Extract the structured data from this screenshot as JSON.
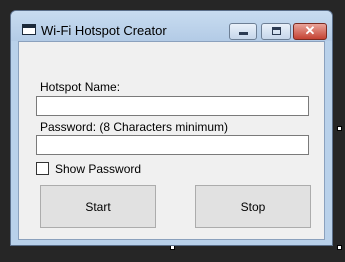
{
  "window": {
    "title": "Wi-Fi Hotspot Creator",
    "close_glyph": "✕",
    "icons": [
      "window-icon",
      "minimize-icon",
      "maximize-icon",
      "close-icon"
    ]
  },
  "form": {
    "hotspot_name_label": "Hotspot Name:",
    "hotspot_name_value": "",
    "password_label": "Password: (8 Characters minimum)",
    "password_value": "",
    "show_password_label": "Show Password",
    "show_password_checked": false
  },
  "buttons": {
    "start_label": "Start",
    "stop_label": "Stop"
  }
}
